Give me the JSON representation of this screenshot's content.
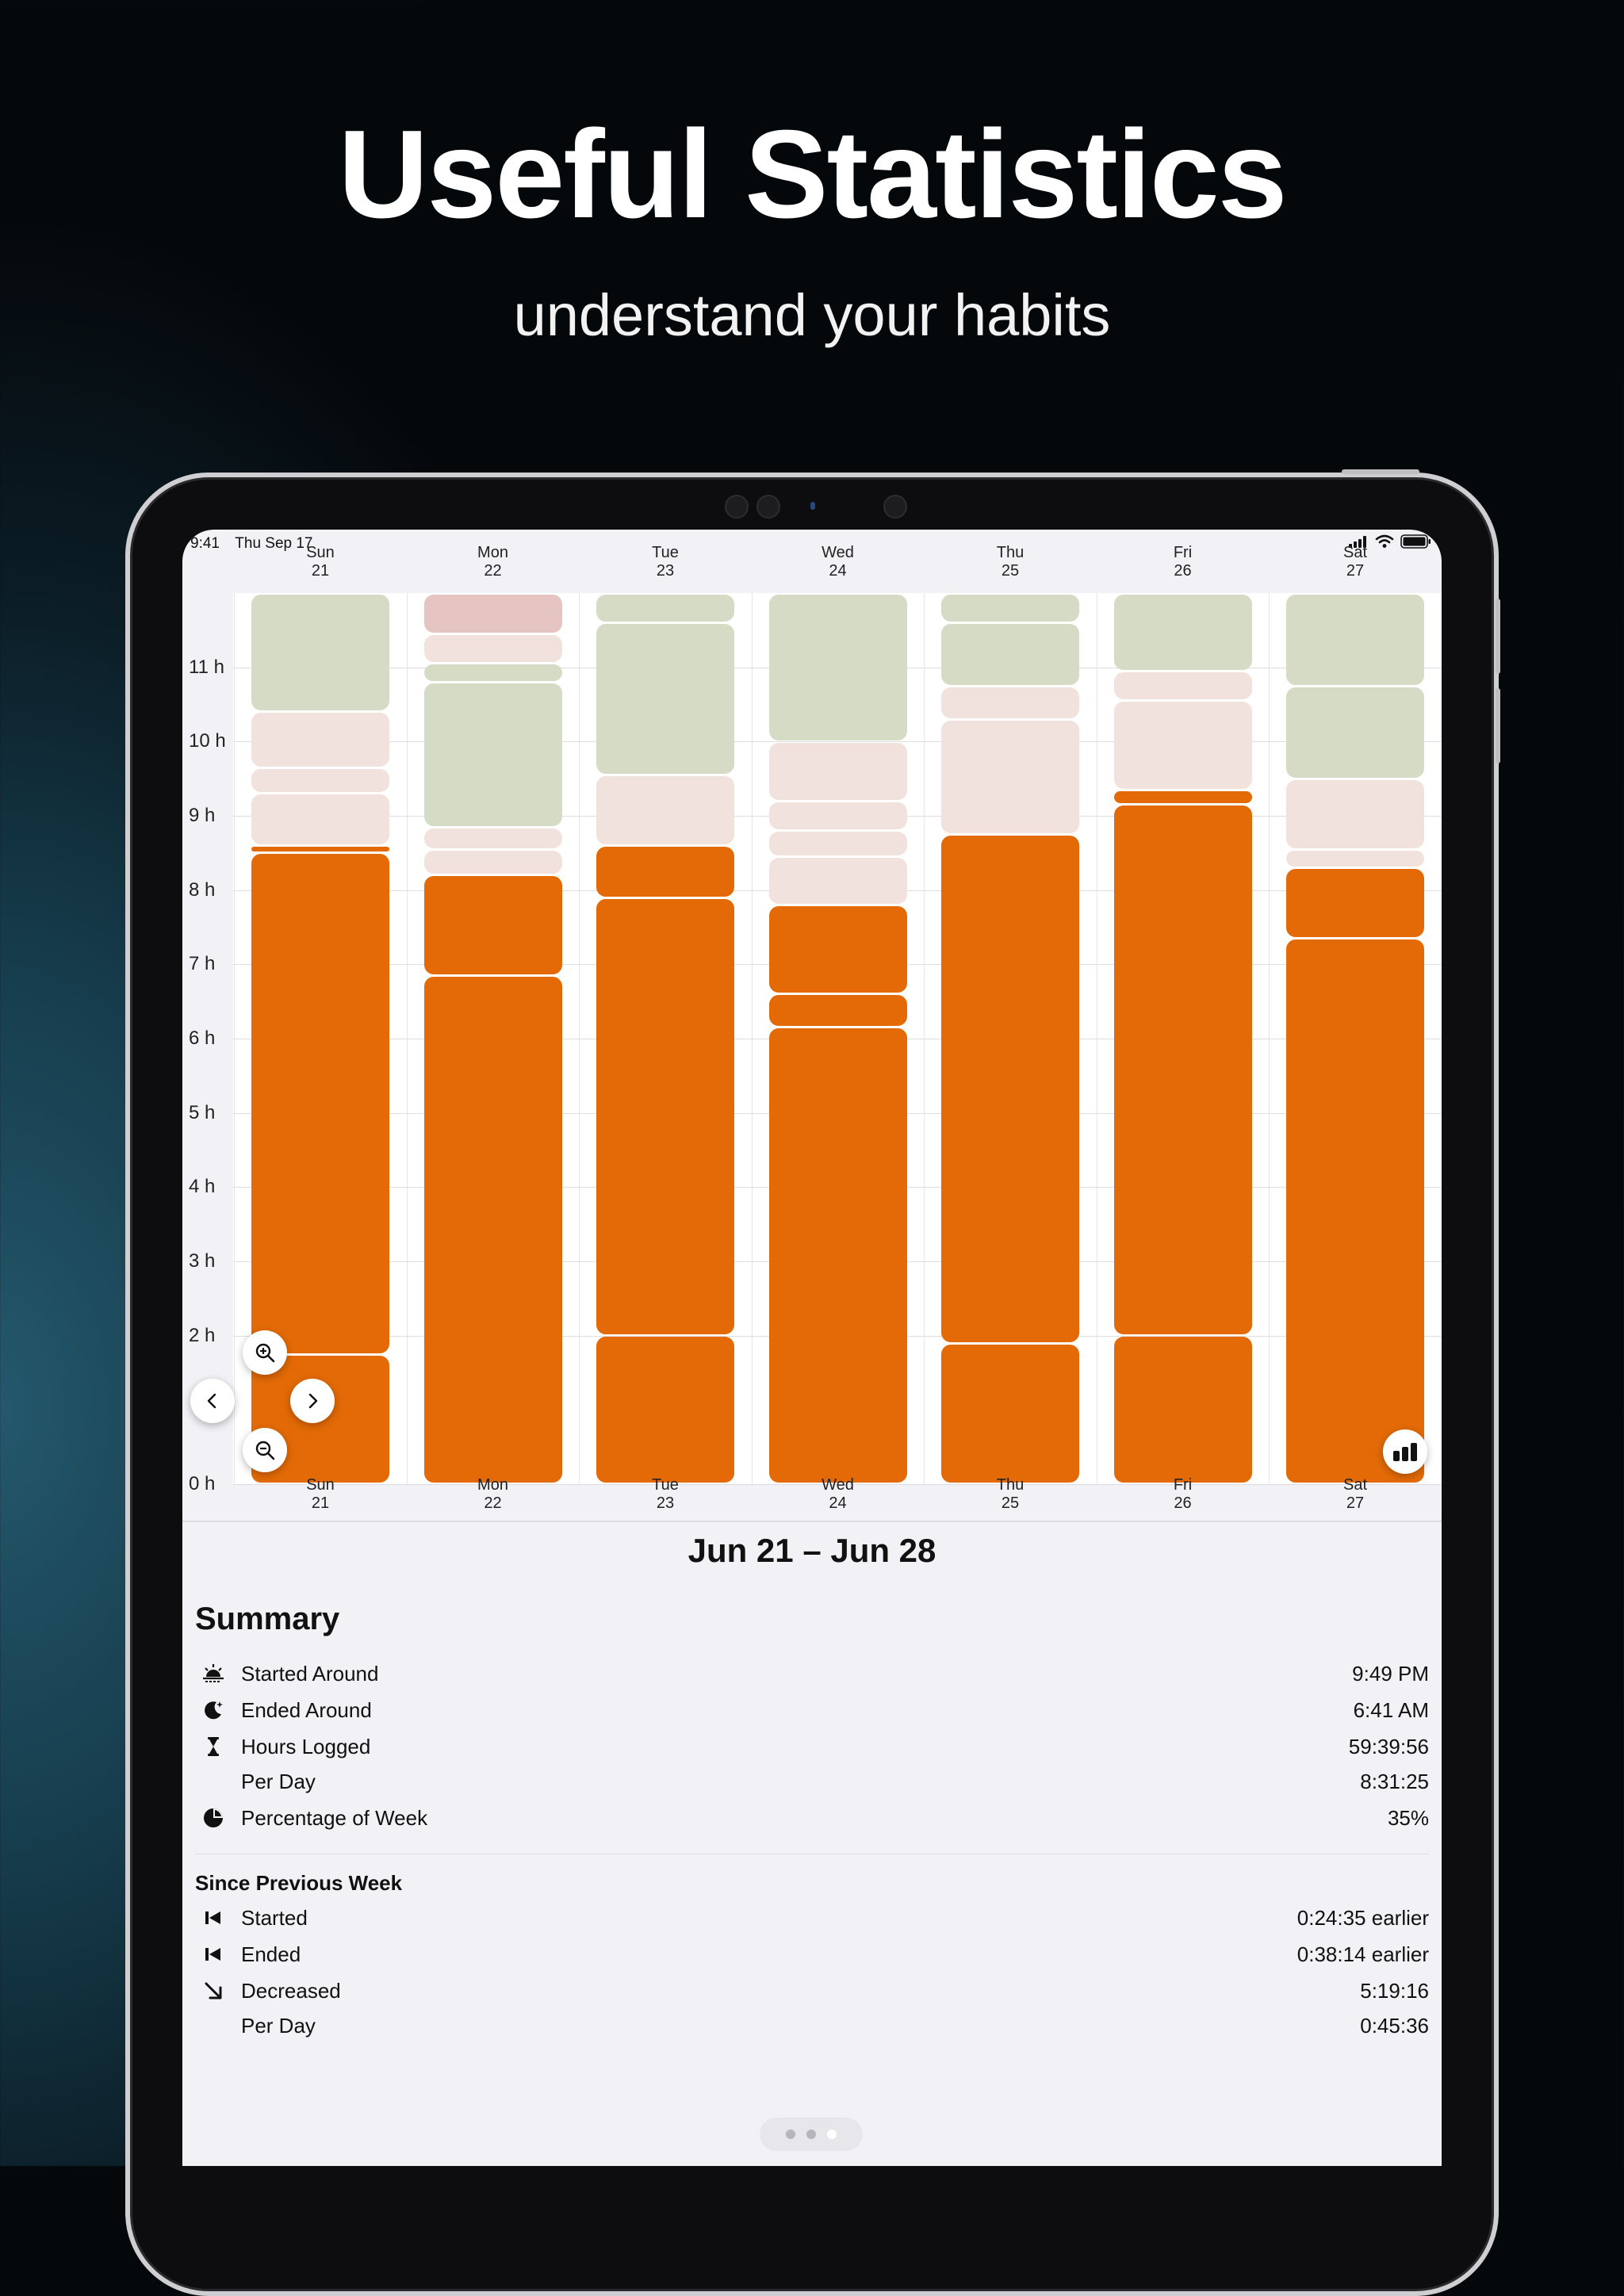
{
  "marketing": {
    "headline": "Useful Statistics",
    "subheadline": "understand your habits"
  },
  "status_bar": {
    "time": "9:41",
    "date": "Thu Sep 17",
    "icons": [
      "cellular-signal-icon",
      "wifi-icon",
      "battery-icon"
    ]
  },
  "chart_data": {
    "type": "bar",
    "stacked": true,
    "categories": [
      "Sun 21",
      "Mon 22",
      "Tue 23",
      "Wed 24",
      "Thu 25",
      "Fri 26",
      "Sat 27"
    ],
    "day_labels": [
      {
        "day": "Sun",
        "date": "21"
      },
      {
        "day": "Mon",
        "date": "22"
      },
      {
        "day": "Tue",
        "date": "23"
      },
      {
        "day": "Wed",
        "date": "24"
      },
      {
        "day": "Thu",
        "date": "25"
      },
      {
        "day": "Fri",
        "date": "26"
      },
      {
        "day": "Sat",
        "date": "27"
      }
    ],
    "y_tick_labels": [
      "0 h",
      "2 h",
      "3 h",
      "4 h",
      "5 h",
      "6 h",
      "7 h",
      "8 h",
      "9 h",
      "10 h",
      "11 h"
    ],
    "y_ticks": [
      0,
      2,
      3,
      4,
      5,
      6,
      7,
      8,
      9,
      10,
      11
    ],
    "ylim": [
      0,
      12
    ],
    "grid": true,
    "segment_colors": {
      "logged": "#e36a06",
      "light": "#f1e2dd",
      "green": "#d6dbc5",
      "red": "#e6c4c2"
    },
    "columns": [
      {
        "segments": [
          {
            "kind": "logged",
            "from": 0,
            "to": 1.75
          },
          {
            "kind": "logged",
            "from": 1.75,
            "to": 8.5
          },
          {
            "kind": "logged",
            "from": 8.5,
            "to": 8.6
          },
          {
            "kind": "light",
            "from": 8.6,
            "to": 9.3
          },
          {
            "kind": "light",
            "from": 9.3,
            "to": 9.65
          },
          {
            "kind": "light",
            "from": 9.65,
            "to": 10.4
          },
          {
            "kind": "green",
            "from": 10.4,
            "to": 12
          }
        ]
      },
      {
        "segments": [
          {
            "kind": "logged",
            "from": 0,
            "to": 6.85
          },
          {
            "kind": "logged",
            "from": 6.85,
            "to": 8.2
          },
          {
            "kind": "light",
            "from": 8.2,
            "to": 8.55
          },
          {
            "kind": "light",
            "from": 8.55,
            "to": 8.85
          },
          {
            "kind": "green",
            "from": 8.85,
            "to": 10.8
          },
          {
            "kind": "green",
            "from": 10.8,
            "to": 11.05
          },
          {
            "kind": "light",
            "from": 11.05,
            "to": 11.45
          },
          {
            "kind": "red",
            "from": 11.45,
            "to": 12
          }
        ]
      },
      {
        "segments": [
          {
            "kind": "logged",
            "from": 0,
            "to": 2.0
          },
          {
            "kind": "logged",
            "from": 2.0,
            "to": 7.9
          },
          {
            "kind": "logged",
            "from": 7.9,
            "to": 8.6
          },
          {
            "kind": "light",
            "from": 8.6,
            "to": 9.55
          },
          {
            "kind": "green",
            "from": 9.55,
            "to": 11.6
          },
          {
            "kind": "green",
            "from": 11.6,
            "to": 12
          }
        ]
      },
      {
        "segments": [
          {
            "kind": "logged",
            "from": 0,
            "to": 6.15
          },
          {
            "kind": "logged",
            "from": 6.15,
            "to": 6.6
          },
          {
            "kind": "logged",
            "from": 6.6,
            "to": 7.8
          },
          {
            "kind": "light",
            "from": 7.8,
            "to": 8.45
          },
          {
            "kind": "light",
            "from": 8.45,
            "to": 8.8
          },
          {
            "kind": "light",
            "from": 8.8,
            "to": 9.2
          },
          {
            "kind": "light",
            "from": 9.2,
            "to": 10.0
          },
          {
            "kind": "green",
            "from": 10.0,
            "to": 12
          }
        ]
      },
      {
        "segments": [
          {
            "kind": "logged",
            "from": 0,
            "to": 1.9
          },
          {
            "kind": "logged",
            "from": 1.9,
            "to": 8.75
          },
          {
            "kind": "light",
            "from": 8.75,
            "to": 10.3
          },
          {
            "kind": "light",
            "from": 10.3,
            "to": 10.75
          },
          {
            "kind": "green",
            "from": 10.75,
            "to": 11.6
          },
          {
            "kind": "green",
            "from": 11.6,
            "to": 12
          }
        ]
      },
      {
        "segments": [
          {
            "kind": "logged",
            "from": 0,
            "to": 2.0
          },
          {
            "kind": "logged",
            "from": 2.0,
            "to": 9.15
          },
          {
            "kind": "logged",
            "from": 9.15,
            "to": 9.35
          },
          {
            "kind": "light",
            "from": 9.35,
            "to": 10.55
          },
          {
            "kind": "light",
            "from": 10.55,
            "to": 10.95
          },
          {
            "kind": "green",
            "from": 10.95,
            "to": 12
          }
        ]
      },
      {
        "segments": [
          {
            "kind": "logged",
            "from": 0,
            "to": 7.35
          },
          {
            "kind": "logged",
            "from": 7.35,
            "to": 8.3
          },
          {
            "kind": "light",
            "from": 8.3,
            "to": 8.55
          },
          {
            "kind": "light",
            "from": 8.55,
            "to": 9.5
          },
          {
            "kind": "green",
            "from": 9.5,
            "to": 10.75
          },
          {
            "kind": "green",
            "from": 10.75,
            "to": 12
          }
        ]
      }
    ]
  },
  "chart_controls": {
    "zoom_in_icon": "zoom-in-icon",
    "zoom_out_icon": "zoom-out-icon",
    "previous_icon": "chevron-left-icon",
    "next_icon": "chevron-right-icon",
    "stats_toggle_icon": "bar-chart-icon"
  },
  "date_range": "Jun 21 – Jun 28",
  "summary": {
    "title": "Summary",
    "rows": [
      {
        "icon": "sunset-icon",
        "label": "Started Around",
        "value": "9:49 PM"
      },
      {
        "icon": "moon-icon",
        "label": "Ended Around",
        "value": "6:41 AM"
      },
      {
        "icon": "hourglass-icon",
        "label": "Hours Logged",
        "value": "59:39:56"
      },
      {
        "icon": "",
        "label": "Per Day",
        "value": "8:31:25"
      },
      {
        "icon": "pie-chart-icon",
        "label": "Percentage of Week",
        "value": "35%"
      }
    ]
  },
  "previous_week": {
    "title": "Since Previous Week",
    "rows": [
      {
        "icon": "skip-back-icon",
        "label": "Started",
        "value": "0:24:35 earlier"
      },
      {
        "icon": "skip-back-icon",
        "label": "Ended",
        "value": "0:38:14 earlier"
      },
      {
        "icon": "arrow-down-right-icon",
        "label": "Decreased",
        "value": "5:19:16"
      },
      {
        "icon": "",
        "label": "Per Day",
        "value": "0:45:36"
      }
    ]
  },
  "page_indicator": {
    "count": 3,
    "current": 3
  }
}
